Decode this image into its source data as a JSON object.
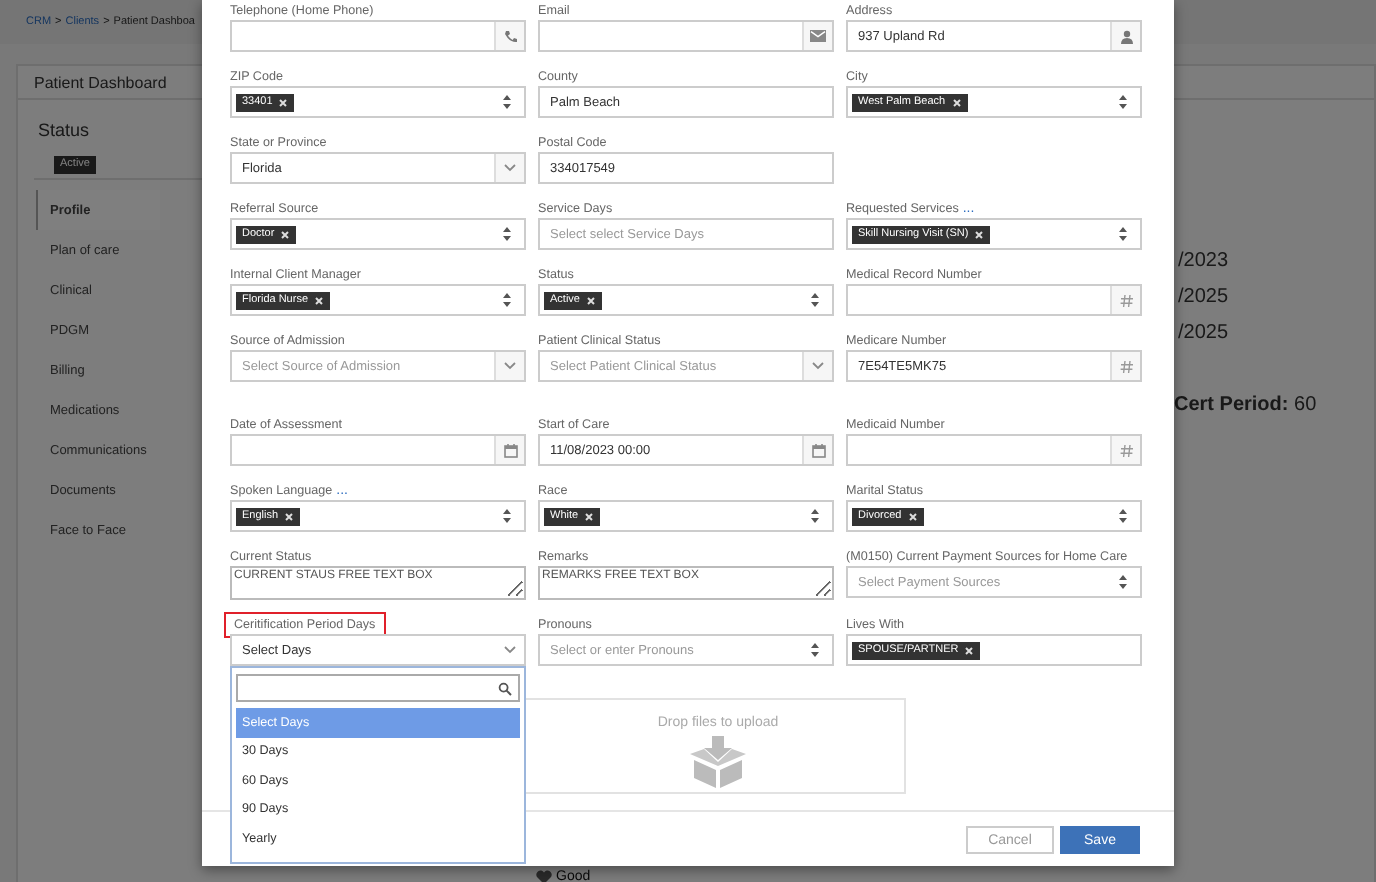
{
  "background": {
    "breadcrumb": {
      "items": [
        "CRM",
        "Clients",
        "Patient Dashboa"
      ],
      "separator": ">"
    },
    "panel_title": "Patient Dashboard",
    "status_label": "Status",
    "status_tag": "Active",
    "nav": [
      {
        "label": "Profile",
        "selected": true
      },
      {
        "label": "Plan of care",
        "selected": false
      },
      {
        "label": "Clinical",
        "selected": false
      },
      {
        "label": "PDGM",
        "selected": false
      },
      {
        "label": "Billing",
        "selected": false
      },
      {
        "label": "Medications",
        "selected": false
      },
      {
        "label": "Communications",
        "selected": false
      },
      {
        "label": "Documents",
        "selected": false
      },
      {
        "label": "Face to Face",
        "selected": false
      }
    ],
    "info_lines": [
      "/2023",
      "/2025",
      "/2025"
    ],
    "cert_period": {
      "label": "Cert Period:",
      "value": "60"
    },
    "footer_link": "Good"
  },
  "modal": {
    "rows": [
      [
        {
          "label": "Telephone (Home Phone)",
          "kind": "phone",
          "highlighted": false
        },
        {
          "label": "Email",
          "kind": "email",
          "highlighted": false
        },
        {
          "label": "Address",
          "kind": "address",
          "value": "937 Upland Rd",
          "highlighted": false
        }
      ],
      [
        {
          "label": "ZIP Code",
          "kind": "tags",
          "tags": [
            "33401"
          ],
          "highlighted": false
        },
        {
          "label": "County",
          "kind": "text",
          "value": "Palm Beach",
          "highlighted": false
        },
        {
          "label": "City",
          "kind": "tags",
          "tags": [
            "West Palm Beach"
          ],
          "highlighted": false
        }
      ],
      [
        {
          "label": "State or Province",
          "kind": "select",
          "value": "Florida",
          "highlighted": false
        },
        {
          "label": "Postal Code",
          "kind": "text",
          "value": "334017549",
          "highlighted": false
        },
        null
      ],
      [
        {
          "label": "Referral Source",
          "kind": "tags",
          "tags": [
            "Doctor"
          ],
          "highlighted": false
        },
        {
          "label": "Service Days",
          "kind": "text",
          "placeholder": "Select select Service Days",
          "highlighted": false
        },
        {
          "label": "Requested Services",
          "link": "...",
          "kind": "tags",
          "tags": [
            "Skill Nursing Visit (SN)"
          ],
          "highlighted": false
        }
      ],
      [
        {
          "label": "Internal Client Manager",
          "kind": "tags",
          "tags": [
            "Florida Nurse"
          ],
          "highlighted": false
        },
        {
          "label": "Status",
          "kind": "tags",
          "tags": [
            "Active"
          ],
          "highlighted": false
        },
        {
          "label": "Medical Record Number",
          "kind": "number",
          "highlighted": false
        }
      ],
      [
        {
          "label": "Source of Admission",
          "kind": "select",
          "placeholder": "Select Source of Admission",
          "highlighted": false
        },
        {
          "label": "Patient Clinical Status",
          "kind": "select",
          "placeholder": "Select Patient Clinical Status",
          "highlighted": false
        },
        {
          "label": "Medicare Number",
          "kind": "number",
          "value": "7E54TE5MK75",
          "highlighted": false
        }
      ],
      [
        {
          "label": "Date of Assessment",
          "kind": "date",
          "highlighted": false
        },
        {
          "label": "Start of Care",
          "kind": "date",
          "value": "11/08/2023 00:00",
          "highlighted": false
        },
        {
          "label": "Medicaid Number",
          "kind": "number",
          "highlighted": false
        }
      ],
      [
        {
          "label": "Spoken Language",
          "link": "...",
          "kind": "tags",
          "tags": [
            "English"
          ],
          "highlighted": false
        },
        {
          "label": "Race",
          "kind": "tags",
          "tags": [
            "White"
          ],
          "highlighted": false
        },
        {
          "label": "Marital Status",
          "kind": "tags",
          "tags": [
            "Divorced"
          ],
          "highlighted": false
        }
      ],
      [
        {
          "label": "Current Status",
          "kind": "textarea",
          "value": "CURRENT STAUS FREE TEXT BOX",
          "highlighted": false
        },
        {
          "label": "Remarks",
          "kind": "textarea",
          "value": "REMARKS FREE TEXT BOX",
          "highlighted": false
        },
        {
          "label": "(M0150) Current Payment Sources for Home Care",
          "kind": "multiselect",
          "placeholder": "Select Payment Sources",
          "highlighted": false
        }
      ],
      [
        {
          "label": "Ceritification Period Days",
          "kind": "select",
          "value": "Select Days",
          "highlighted": true,
          "dropdown": {
            "options": [
              {
                "label": "Select Days",
                "selected": true
              },
              {
                "label": "30 Days",
                "selected": false
              },
              {
                "label": "60 Days",
                "selected": false
              },
              {
                "label": "90 Days",
                "selected": false
              },
              {
                "label": "Yearly",
                "selected": false
              }
            ]
          }
        },
        {
          "label": "Pronouns",
          "kind": "multiselect",
          "placeholder": "Select or enter Pronouns",
          "highlighted": false
        },
        {
          "label": "Lives With",
          "kind": "tagbox",
          "tags": [
            "SPOUSE/PARTNER"
          ],
          "highlighted": false
        }
      ]
    ],
    "dropzone": {
      "text": "Drop files to upload"
    },
    "buttons": [
      {
        "label": "Cancel",
        "kind": "secondary"
      },
      {
        "label": "Save",
        "kind": "primary"
      }
    ]
  }
}
